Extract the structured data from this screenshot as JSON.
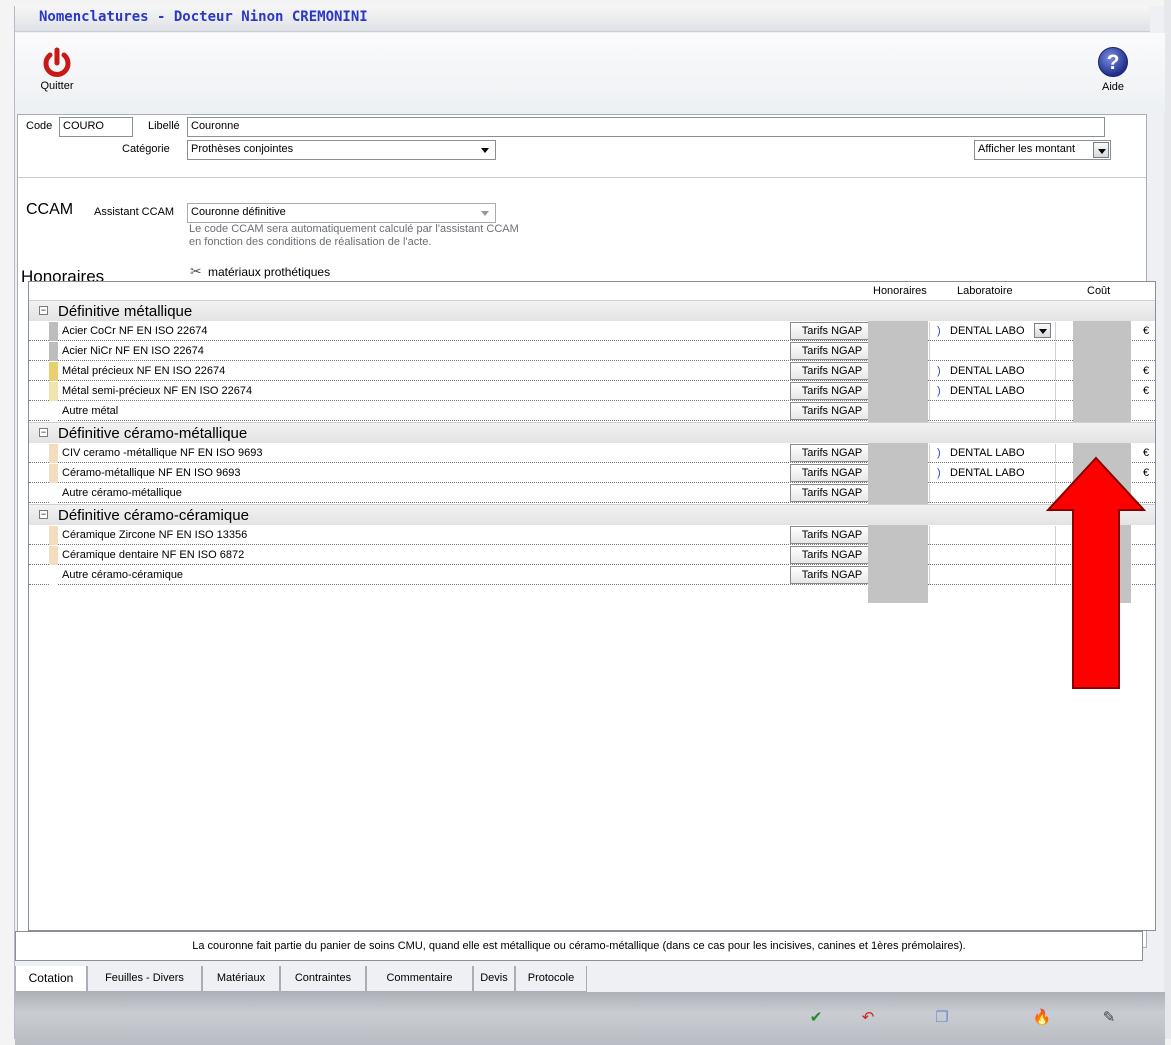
{
  "window": {
    "title": "Nomenclatures - Docteur Ninon CREMONINI"
  },
  "toolbar": {
    "quit_label": "Quitter",
    "help_label": "Aide",
    "help_glyph": "?"
  },
  "form": {
    "code_label": "Code",
    "code_value": "COURO",
    "libelle_label": "Libellé",
    "libelle_value": "Couronne",
    "categorie_label": "Catégorie",
    "categorie_value": "Prothèses conjointes",
    "afficher_value": "Afficher les montant"
  },
  "ccam": {
    "title": "CCAM",
    "assistant_label": "Assistant CCAM",
    "assistant_value": "Couronne définitive",
    "hint_line1": "Le code CCAM sera automatiquement calculé par l'assistant CCAM",
    "hint_line2": "en fonction des conditions de réalisation de l'acte."
  },
  "honoraires": {
    "title": "Honoraires",
    "materials_link": "matériaux prothétiques"
  },
  "grid": {
    "col_honoraires": "Honoraires",
    "col_laboratoire": "Laboratoire",
    "col_cout": "Coût",
    "groups": [
      {
        "name": "Définitive métallique",
        "toggle": "−",
        "rows": [
          {
            "name": "Acier CoCr NF EN ISO 22674",
            "tarif": "Tarifs NGAP",
            "lab": "DENTAL LABO",
            "euro": "€",
            "color": "#bdbdbd"
          },
          {
            "name": "Acier NiCr NF EN ISO 22674",
            "tarif": "Tarifs NGAP",
            "lab": "",
            "euro": "",
            "color": "#bdbdbd"
          },
          {
            "name": "Métal précieux NF EN ISO 22674",
            "tarif": "Tarifs NGAP",
            "lab": "DENTAL LABO",
            "euro": "€",
            "color": "#e9cf6f"
          },
          {
            "name": "Métal semi-précieux NF EN ISO 22674",
            "tarif": "Tarifs NGAP",
            "lab": "DENTAL LABO",
            "euro": "€",
            "color": "#efe3ae"
          },
          {
            "name": "Autre métal",
            "tarif": "Tarifs NGAP",
            "lab": "",
            "euro": "",
            "color": "#ffffff"
          }
        ]
      },
      {
        "name": "Définitive céramo-métallique",
        "toggle": "−",
        "rows": [
          {
            "name": "CIV ceramo -métallique NF EN ISO 9693",
            "tarif": "Tarifs NGAP",
            "lab": "DENTAL LABO",
            "euro": "€",
            "color": "#f3dcc0"
          },
          {
            "name": "Céramo-métallique NF EN ISO 9693",
            "tarif": "Tarifs NGAP",
            "lab": "DENTAL LABO",
            "euro": "€",
            "color": "#f3dcc0"
          },
          {
            "name": "Autre céramo-métallique",
            "tarif": "Tarifs NGAP",
            "lab": "",
            "euro": "",
            "color": "#ffffff"
          }
        ]
      },
      {
        "name": "Définitive céramo-céramique",
        "toggle": "−",
        "rows": [
          {
            "name": "Céramique Zircone NF EN ISO 13356",
            "tarif": "Tarifs NGAP",
            "lab": "",
            "euro": "",
            "color": "#f3dcc0"
          },
          {
            "name": "Céramique dentaire NF EN ISO 6872",
            "tarif": "Tarifs NGAP",
            "lab": "",
            "euro": "",
            "color": "#f3dcc0"
          },
          {
            "name": "Autre céramo-céramique",
            "tarif": "Tarifs NGAP",
            "lab": "",
            "euro": "",
            "color": "#ffffff"
          }
        ]
      }
    ]
  },
  "note": "La couronne fait partie du panier de soins CMU, quand elle est métallique ou céramo-métallique (dans ce cas pour les incisives, canines et 1ères prémolaires).",
  "tabs": [
    "Cotation",
    "Feuilles - Divers",
    "Matériaux",
    "Contraintes",
    "Commentaire",
    "Devis",
    "Protocole"
  ],
  "statusbar": {
    "icons": [
      {
        "name": "validate-icon",
        "glyph": "✔",
        "color": "#2a8a2a"
      },
      {
        "name": "undo-icon",
        "glyph": "↶",
        "color": "#d02020"
      },
      {
        "name": "copy-icon",
        "glyph": "❐",
        "color": "#6a8fd0"
      },
      {
        "name": "fire-icon",
        "glyph": "🔥",
        "color": "#f07010"
      },
      {
        "name": "magic-wand-icon",
        "glyph": "✎",
        "color": "#444"
      }
    ]
  },
  "colors": {
    "title_blue": "#2a38c6",
    "arrow_red": "#ff0000",
    "quit_red": "#c81818"
  }
}
